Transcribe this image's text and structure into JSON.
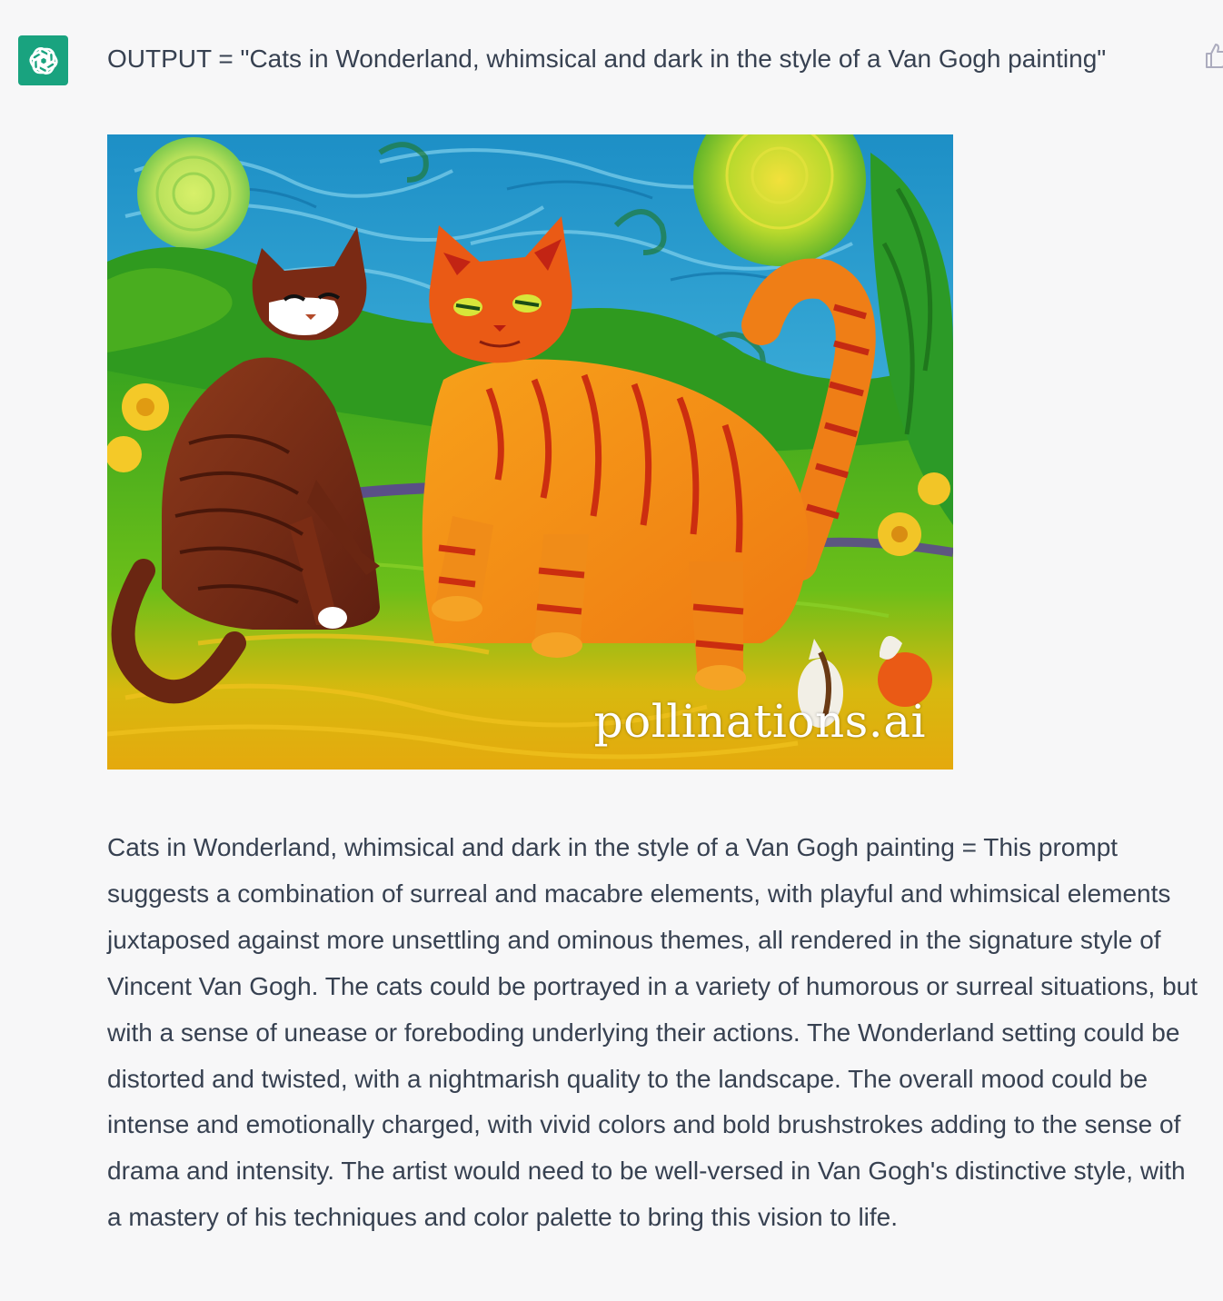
{
  "colors": {
    "avatar_bg": "#19a37f",
    "text": "#374151",
    "page_bg": "#f7f7f8",
    "thumb_icon": "#acacbe"
  },
  "assistant": {
    "avatar_icon": "openai-logo-icon"
  },
  "message": {
    "prompt_line": "OUTPUT = \"Cats in Wonderland, whimsical and dark in the style of a Van Gogh painting\"",
    "image": {
      "watermark": "pollinations.ai"
    },
    "answer": "Cats in Wonderland, whimsical and dark in the style of a Van Gogh painting = This prompt suggests a combination of surreal and macabre elements, with playful and whimsical elements juxtaposed against more unsettling and ominous themes, all rendered in the signature style of Vincent Van Gogh. The cats could be portrayed in a variety of humorous or surreal situations, but with a sense of unease or foreboding underlying their actions. The Wonderland setting could be distorted and twisted, with a nightmarish quality to the landscape. The overall mood could be intense and emotionally charged, with vivid colors and bold brushstrokes adding to the sense of drama and intensity. The artist would need to be well-versed in Van Gogh's distinctive style, with a mastery of his techniques and color palette to bring this vision to life."
  },
  "actions": {
    "thumbs_up_icon": "thumbs-up-icon"
  }
}
